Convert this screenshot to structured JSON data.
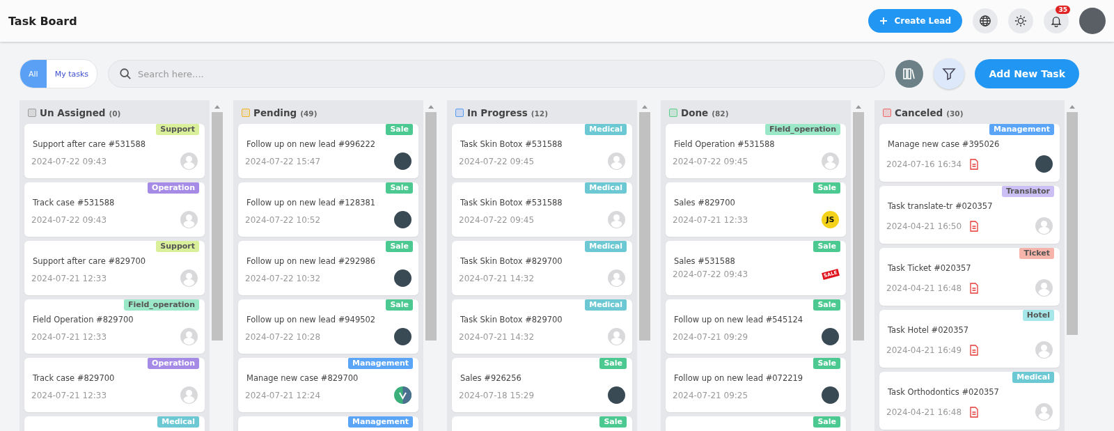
{
  "header": {
    "title": "Task Board",
    "create_button": "Create Lead",
    "notification_count": "35"
  },
  "toolbar": {
    "filters": [
      {
        "label": "All",
        "selected": true
      },
      {
        "label": "My tasks",
        "selected": false
      }
    ],
    "search": {
      "placeholder": "Search here...."
    },
    "add_button": "Add New Task"
  },
  "columns": [
    {
      "title": "Un Assigned",
      "count": "(0)",
      "color": "#9e9e9e",
      "cards": [
        {
          "tag": "Support",
          "color": "#d9ef9a",
          "title": "Support after care #531588",
          "date": "2024-07-22 09:43",
          "document": false,
          "kind": "placeholder"
        },
        {
          "tag": "Operation",
          "color": "#a58be6",
          "title": "Track case #531588",
          "date": "2024-07-22 09:43",
          "document": false,
          "kind": "placeholder"
        },
        {
          "tag": "Support",
          "color": "#d9ef9a",
          "title": "Support after care #829700",
          "date": "2024-07-21 12:33",
          "document": false,
          "kind": "placeholder"
        },
        {
          "tag": "Field_operation",
          "color": "#9be8c8",
          "title": "Field Operation #829700",
          "date": "2024-07-21 12:33",
          "document": false,
          "kind": "placeholder"
        },
        {
          "tag": "Operation",
          "color": "#a58be6",
          "title": "Track case #829700",
          "date": "2024-07-21 12:33",
          "document": false,
          "kind": "placeholder"
        },
        {
          "tag": "Medical",
          "color": "#6cc9d3"
        }
      ]
    },
    {
      "title": "Pending",
      "count": "(49)",
      "color": "#f0b429",
      "cards": [
        {
          "tag": "Sale",
          "color": "#4cc990",
          "title": "Follow up on new lead #996222",
          "date": "2024-07-22 15:47",
          "document": false,
          "kind": "photo"
        },
        {
          "tag": "Sale",
          "color": "#4cc990",
          "title": "Follow up on new lead #128381",
          "date": "2024-07-22 10:52",
          "document": false,
          "kind": "photo"
        },
        {
          "tag": "Sale",
          "color": "#4cc990",
          "title": "Follow up on new lead #292986",
          "date": "2024-07-22 10:32",
          "document": false,
          "kind": "photo"
        },
        {
          "tag": "Sale",
          "color": "#4cc990",
          "title": "Follow up on new lead #949502",
          "date": "2024-07-22 10:28",
          "document": false,
          "kind": "photo"
        },
        {
          "tag": "Management",
          "color": "#5aa5f7",
          "title": "Manage new case #829700",
          "date": "2024-07-21 12:24",
          "document": false,
          "kind": "vlogo"
        },
        {
          "tag": "Management",
          "color": "#5aa5f7"
        }
      ]
    },
    {
      "title": "In Progress",
      "count": "(12)",
      "color": "#5b9cf5",
      "cards": [
        {
          "tag": "Medical",
          "color": "#6cc9d3",
          "title": "Task Skin Botox #531588",
          "date": "2024-07-22 09:45",
          "document": false,
          "kind": "placeholder"
        },
        {
          "tag": "Medical",
          "color": "#6cc9d3",
          "title": "Task Skin Botox #531588",
          "date": "2024-07-22 09:45",
          "document": false,
          "kind": "placeholder"
        },
        {
          "tag": "Medical",
          "color": "#6cc9d3",
          "title": "Task Skin Botox #829700",
          "date": "2024-07-21 14:32",
          "document": false,
          "kind": "placeholder"
        },
        {
          "tag": "Medical",
          "color": "#6cc9d3",
          "title": "Task Skin Botox #829700",
          "date": "2024-07-21 14:32",
          "document": false,
          "kind": "placeholder"
        },
        {
          "tag": "Sale",
          "color": "#4cc990",
          "title": "Sales #926256",
          "date": "2024-07-18 15:29",
          "document": false,
          "kind": "photo"
        },
        {
          "tag": "Sale",
          "color": "#4cc990"
        }
      ]
    },
    {
      "title": "Done",
      "count": "(82)",
      "color": "#5ccf8a",
      "cards": [
        {
          "tag": "Field_operation",
          "color": "#9be8c8",
          "title": "Field Operation #531588",
          "date": "2024-07-22 09:45",
          "document": false,
          "kind": "placeholder"
        },
        {
          "tag": "Sale",
          "color": "#4cc990",
          "title": "Sales #829700",
          "date": "2024-07-21 12:33",
          "document": false,
          "kind": "logo",
          "avatar_text": "JS"
        },
        {
          "tag": "Sale",
          "color": "#4cc990",
          "title": "Sales #531588",
          "date": "2024-07-22 09:43",
          "document": false,
          "kind": "sticker",
          "avatar_text": "SALE"
        },
        {
          "tag": "Sale",
          "color": "#4cc990",
          "title": "Follow up on new lead #545124",
          "date": "2024-07-21 09:29",
          "document": false,
          "kind": "photo"
        },
        {
          "tag": "Sale",
          "color": "#4cc990",
          "title": "Follow up on new lead #072219",
          "date": "2024-07-21 09:25",
          "document": false,
          "kind": "photo"
        },
        {
          "tag": "Sale",
          "color": "#4cc990"
        }
      ]
    },
    {
      "title": "Canceled",
      "count": "(30)",
      "color": "#ef6b6b",
      "cards": [
        {
          "tag": "Management",
          "color": "#5aa5f7",
          "title": "Manage new case #395026",
          "date": "2024-07-16 16:34",
          "document": true,
          "kind": "photo"
        },
        {
          "tag": "Translator",
          "color": "#cbbff5",
          "title": "Task translate-tr #020357",
          "date": "2024-04-21 16:50",
          "document": true,
          "kind": "placeholder"
        },
        {
          "tag": "Ticket",
          "color": "#f7b4aa",
          "title": "Task Ticket #020357",
          "date": "2024-04-21 16:48",
          "document": true,
          "kind": "placeholder"
        },
        {
          "tag": "Hotel",
          "color": "#a6e8ea",
          "title": "Task Hotel #020357",
          "date": "2024-04-21 16:49",
          "document": true,
          "kind": "placeholder"
        },
        {
          "tag": "Medical",
          "color": "#6cc9d3",
          "title": "Task Orthodontics #020357",
          "date": "2024-04-21 16:48",
          "document": true,
          "kind": "placeholder"
        }
      ]
    }
  ]
}
